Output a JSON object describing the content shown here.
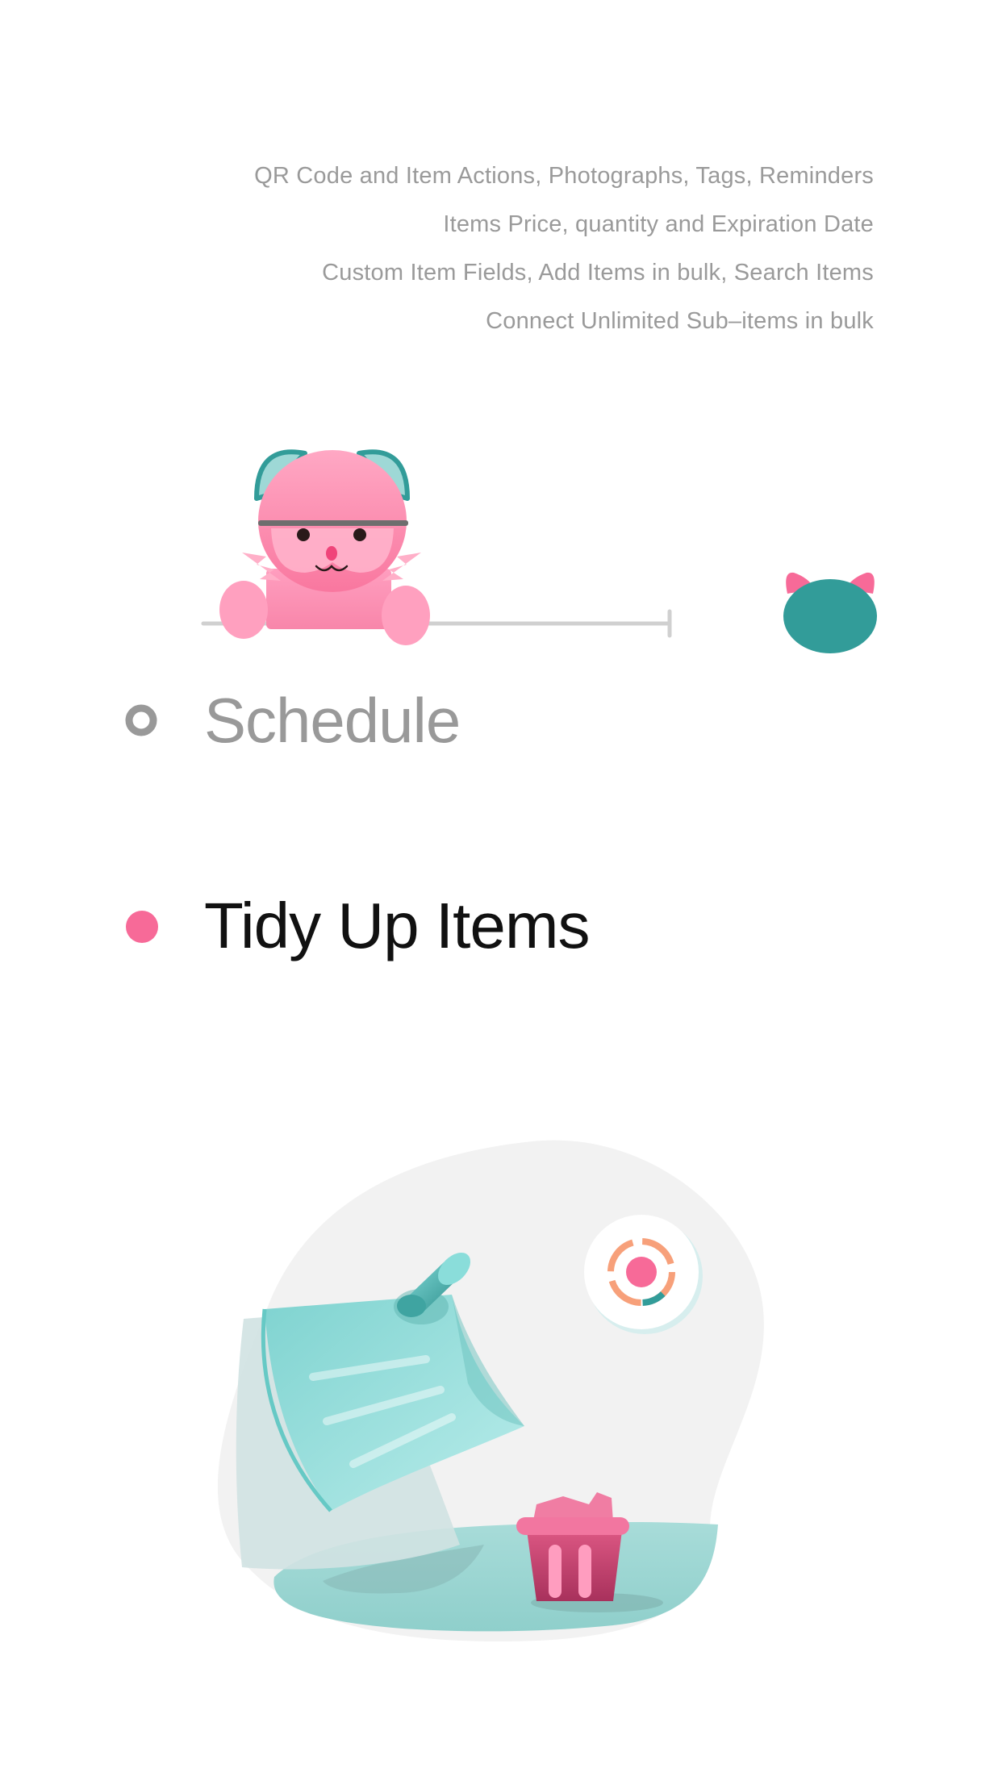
{
  "features": [
    "QR Code and Item Actions, Photographs, Tags, Reminders",
    "Items Price, quantity and Expiration Date",
    "Custom Item Fields, Add Items in bulk, Search Items",
    "Connect Unlimited Sub–items in bulk"
  ],
  "menu": {
    "schedule": {
      "label": "Schedule",
      "active": false
    },
    "tidy_up": {
      "label": "Tidy Up Items",
      "active": true
    }
  },
  "colors": {
    "accent_pink": "#F76A98",
    "teal": "#329C99",
    "inactive_gray": "#999999",
    "text_dark": "#111111",
    "feature_text": "#9A9A9A"
  },
  "icons": {
    "mascot": "pink-cat-icon",
    "small_cat": "teal-cat-head-icon",
    "note": "sticky-note-icon",
    "pin": "push-pin-icon",
    "target": "target-icon",
    "basket": "basket-icon"
  }
}
